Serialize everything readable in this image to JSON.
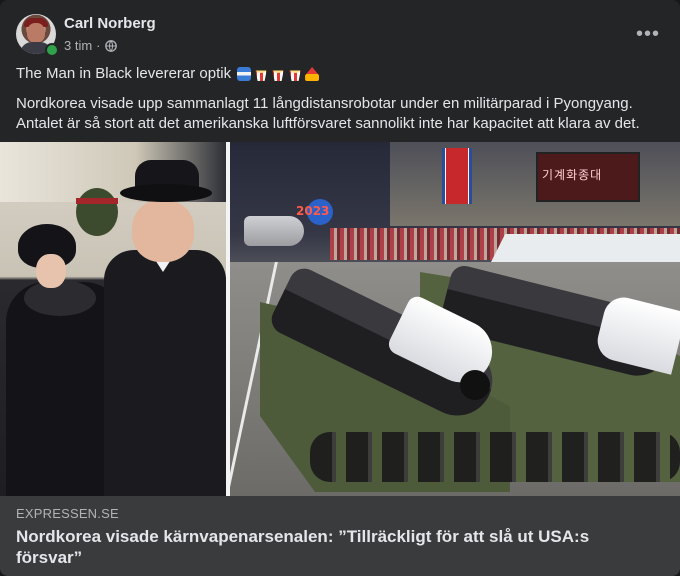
{
  "post": {
    "author": "Carl Norberg",
    "time": "3 tim",
    "separator": "·",
    "privacy_icon": "globe-icon",
    "more_icon": "more-options-icon",
    "more_label": "•••",
    "line1": "The Man in Black levererar optik",
    "emojis": [
      "drum-emoji",
      "popcorn-emoji",
      "popcorn-emoji",
      "popcorn-emoji",
      "circus-tent-emoji"
    ],
    "body": "Nordkorea visade upp sammanlagt 11 långdistansrobotar under en militärparad i Pyongyang. Antalet är så stort att det amerikanska luftförsvaret sannolikt inte har kapacitet att klara av det."
  },
  "media": {
    "banner_text": "기계화종대",
    "year_text": "2023"
  },
  "link": {
    "domain": "EXPRESSEN.SE",
    "headline": "Nordkorea visade kärnvapenarsenalen: ”Tillräckligt för att slå ut USA:s försvar”"
  },
  "colors": {
    "card_bg": "#242526",
    "link_bg": "#3a3b3c",
    "primary_text": "#e4e6eb",
    "secondary_text": "#b0b3b8",
    "online": "#31a24c"
  }
}
